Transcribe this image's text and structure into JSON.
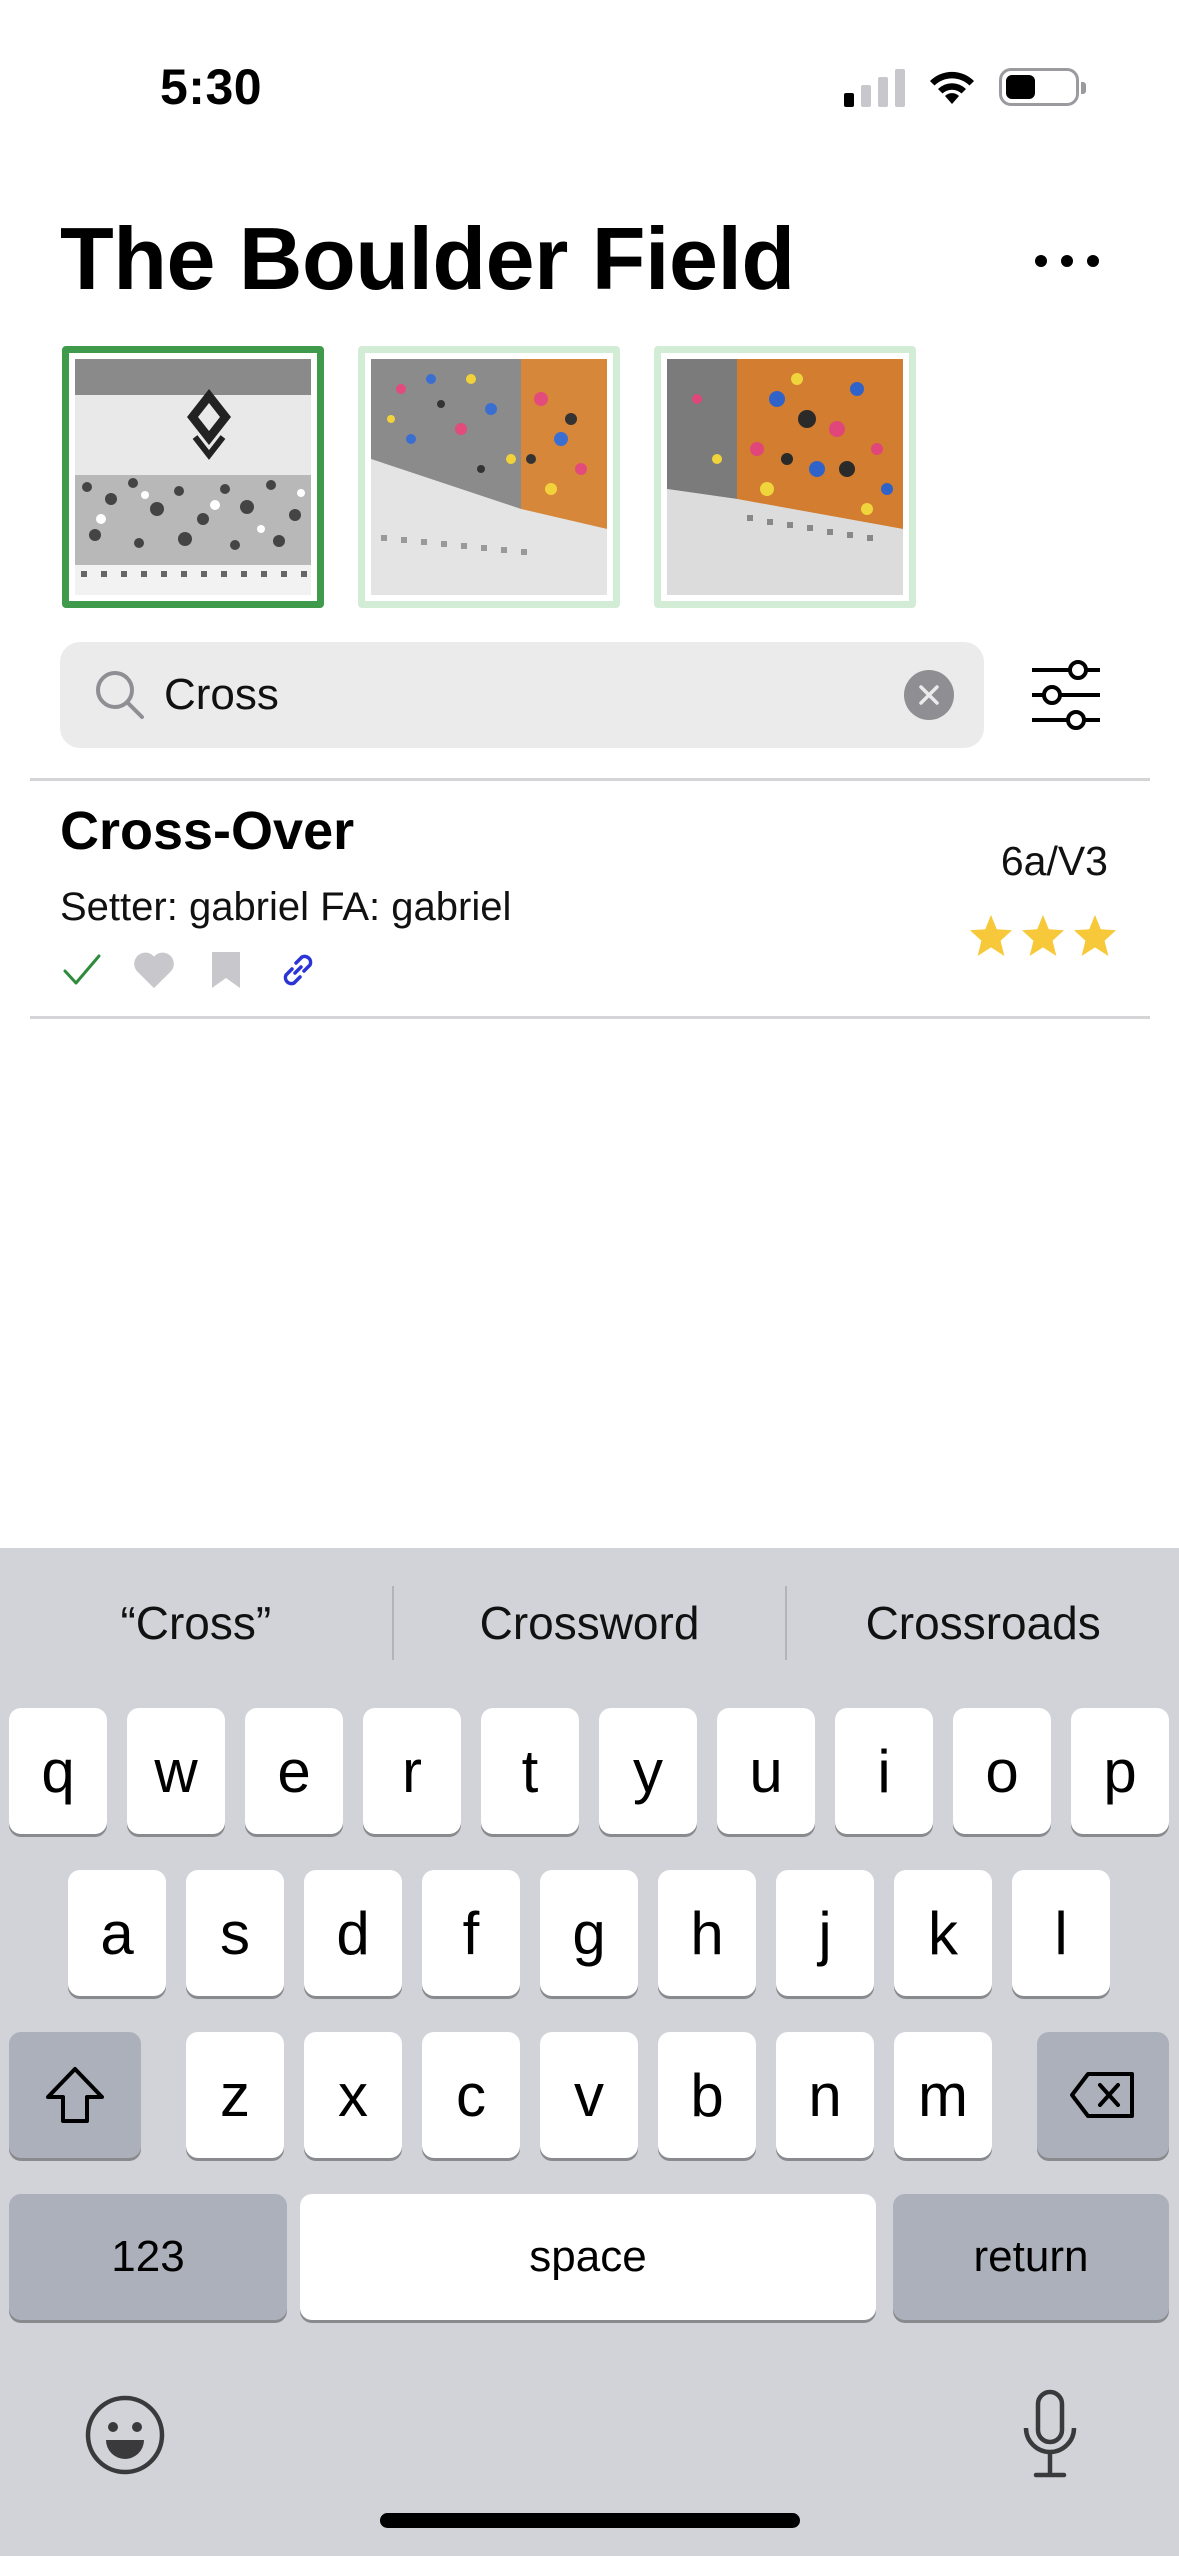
{
  "status_bar": {
    "time": "5:30"
  },
  "header": {
    "title": "The Boulder Field"
  },
  "walls": [
    {
      "name": "wall-1",
      "selected": true
    },
    {
      "name": "wall-2",
      "selected": false
    },
    {
      "name": "wall-3",
      "selected": false
    }
  ],
  "search": {
    "value": "Cross"
  },
  "routes": [
    {
      "name": "Cross-Over",
      "setter_line": "Setter: gabriel FA: gabriel",
      "grade": "6a/V3",
      "stars": 3,
      "icons": [
        "checkmark-icon",
        "heart-icon",
        "bookmark-icon",
        "link-icon"
      ]
    }
  ],
  "keyboard": {
    "suggestions": [
      "“Cross”",
      "Crossword",
      "Crossroads"
    ],
    "row1": [
      "q",
      "w",
      "e",
      "r",
      "t",
      "y",
      "u",
      "i",
      "o",
      "p"
    ],
    "row2": [
      "a",
      "s",
      "d",
      "f",
      "g",
      "h",
      "j",
      "k",
      "l"
    ],
    "row3": [
      "z",
      "x",
      "c",
      "v",
      "b",
      "n",
      "m"
    ],
    "numbers_label": "123",
    "space_label": "space",
    "return_label": "return"
  },
  "colors": {
    "selected_border": "#3f9a4b",
    "thumb_border": "#d3ecd6",
    "star": "#f7c93a",
    "link": "#2b35d6",
    "check": "#2e8b3c",
    "icon_gray": "#c8c8cc",
    "keyboard_bg": "#d1d3d9"
  }
}
